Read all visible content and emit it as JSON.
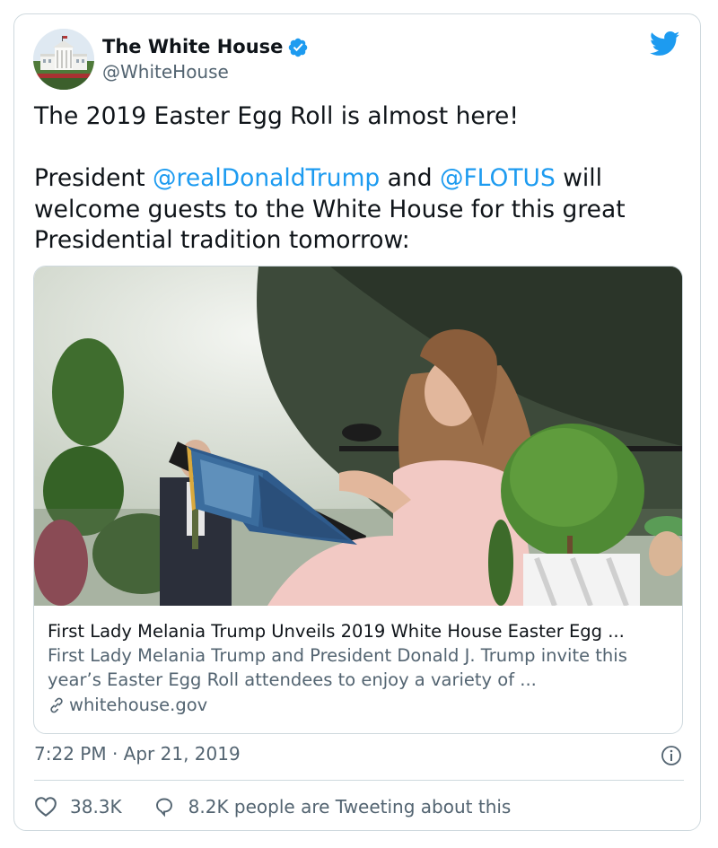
{
  "author": {
    "display_name": "The White House",
    "handle": "@WhiteHouse",
    "verified": true,
    "avatar_icon": "white-house-avatar"
  },
  "tweet": {
    "line1": "The 2019 Easter Egg Roll is almost here!",
    "p2_prefix": "President ",
    "mention1": "@realDonaldTrump",
    "p2_middle": " and ",
    "mention2": "@FLOTUS",
    "p2_suffix": " will welcome guests to the White House for this great Presidential tradition tomorrow:"
  },
  "link_card": {
    "image_icon": "first-lady-reading-storybook-photo",
    "title": "First Lady Melania Trump Unveils 2019 White House Easter Egg ...",
    "description": "First Lady Melania Trump and President Donald J. Trump invite this year’s Easter Egg Roll attendees to enjoy a variety of ...",
    "domain": "whitehouse.gov"
  },
  "meta": {
    "timestamp": "7:22 PM · Apr 21, 2019"
  },
  "actions": {
    "likes": "38.3K",
    "tweeting": "8.2K people are Tweeting about this"
  },
  "colors": {
    "accent": "#1d9bf0",
    "text": "#0f1419",
    "secondary": "#536471",
    "border": "#cfd9de"
  }
}
